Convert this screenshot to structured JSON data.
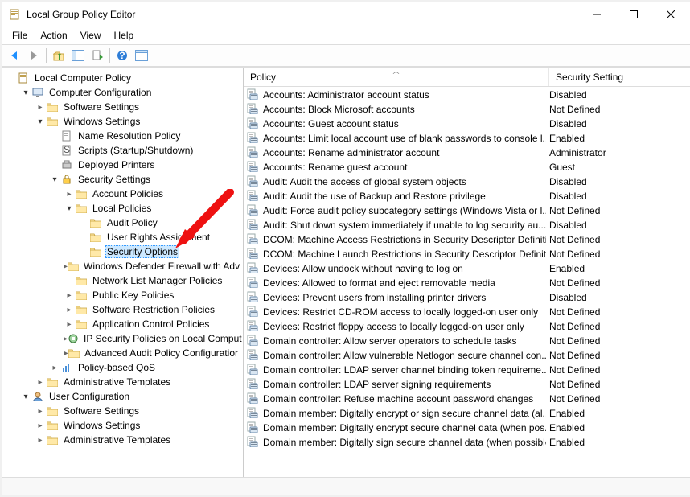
{
  "window": {
    "title": "Local Group Policy Editor"
  },
  "menu": {
    "file": "File",
    "action": "Action",
    "view": "View",
    "help": "Help"
  },
  "columns": {
    "policy": "Policy",
    "setting": "Security Setting"
  },
  "tree": [
    {
      "indent": 0,
      "chev": "none",
      "icon": "book",
      "label": "Local Computer Policy"
    },
    {
      "indent": 1,
      "chev": "open",
      "icon": "computer",
      "label": "Computer Configuration"
    },
    {
      "indent": 2,
      "chev": "closed",
      "icon": "folder",
      "label": "Software Settings"
    },
    {
      "indent": 2,
      "chev": "open",
      "icon": "folder",
      "label": "Windows Settings"
    },
    {
      "indent": 3,
      "chev": "none",
      "icon": "doc",
      "label": "Name Resolution Policy"
    },
    {
      "indent": 3,
      "chev": "none",
      "icon": "script",
      "label": "Scripts (Startup/Shutdown)"
    },
    {
      "indent": 3,
      "chev": "none",
      "icon": "printer",
      "label": "Deployed Printers"
    },
    {
      "indent": 3,
      "chev": "open",
      "icon": "security",
      "label": "Security Settings"
    },
    {
      "indent": 4,
      "chev": "closed",
      "icon": "folder",
      "label": "Account Policies"
    },
    {
      "indent": 4,
      "chev": "open",
      "icon": "folder",
      "label": "Local Policies"
    },
    {
      "indent": 5,
      "chev": "none",
      "icon": "folder",
      "label": "Audit Policy"
    },
    {
      "indent": 5,
      "chev": "none",
      "icon": "folder",
      "label": "User Rights Assignment"
    },
    {
      "indent": 5,
      "chev": "none",
      "icon": "folder",
      "label": "Security Options",
      "selected": true
    },
    {
      "indent": 4,
      "chev": "closed",
      "icon": "folder",
      "label": "Windows Defender Firewall with Adv"
    },
    {
      "indent": 4,
      "chev": "none",
      "icon": "folder",
      "label": "Network List Manager Policies"
    },
    {
      "indent": 4,
      "chev": "closed",
      "icon": "folder",
      "label": "Public Key Policies"
    },
    {
      "indent": 4,
      "chev": "closed",
      "icon": "folder",
      "label": "Software Restriction Policies"
    },
    {
      "indent": 4,
      "chev": "closed",
      "icon": "folder",
      "label": "Application Control Policies"
    },
    {
      "indent": 4,
      "chev": "closed",
      "icon": "ipsec",
      "label": "IP Security Policies on Local Comput"
    },
    {
      "indent": 4,
      "chev": "closed",
      "icon": "folder",
      "label": "Advanced Audit Policy Configuratior"
    },
    {
      "indent": 3,
      "chev": "closed",
      "icon": "qos",
      "label": "Policy-based QoS"
    },
    {
      "indent": 2,
      "chev": "closed",
      "icon": "folder",
      "label": "Administrative Templates"
    },
    {
      "indent": 1,
      "chev": "open",
      "icon": "user",
      "label": "User Configuration"
    },
    {
      "indent": 2,
      "chev": "closed",
      "icon": "folder",
      "label": "Software Settings"
    },
    {
      "indent": 2,
      "chev": "closed",
      "icon": "folder",
      "label": "Windows Settings"
    },
    {
      "indent": 2,
      "chev": "closed",
      "icon": "folder",
      "label": "Administrative Templates"
    }
  ],
  "policies": [
    {
      "name": "Accounts: Administrator account status",
      "setting": "Disabled"
    },
    {
      "name": "Accounts: Block Microsoft accounts",
      "setting": "Not Defined"
    },
    {
      "name": "Accounts: Guest account status",
      "setting": "Disabled"
    },
    {
      "name": "Accounts: Limit local account use of blank passwords to console l...",
      "setting": "Enabled"
    },
    {
      "name": "Accounts: Rename administrator account",
      "setting": "Administrator"
    },
    {
      "name": "Accounts: Rename guest account",
      "setting": "Guest"
    },
    {
      "name": "Audit: Audit the access of global system objects",
      "setting": "Disabled"
    },
    {
      "name": "Audit: Audit the use of Backup and Restore privilege",
      "setting": "Disabled"
    },
    {
      "name": "Audit: Force audit policy subcategory settings (Windows Vista or l...",
      "setting": "Not Defined"
    },
    {
      "name": "Audit: Shut down system immediately if unable to log security au...",
      "setting": "Disabled"
    },
    {
      "name": "DCOM: Machine Access Restrictions in Security Descriptor Definiti...",
      "setting": "Not Defined"
    },
    {
      "name": "DCOM: Machine Launch Restrictions in Security Descriptor Definit...",
      "setting": "Not Defined"
    },
    {
      "name": "Devices: Allow undock without having to log on",
      "setting": "Enabled"
    },
    {
      "name": "Devices: Allowed to format and eject removable media",
      "setting": "Not Defined"
    },
    {
      "name": "Devices: Prevent users from installing printer drivers",
      "setting": "Disabled"
    },
    {
      "name": "Devices: Restrict CD-ROM access to locally logged-on user only",
      "setting": "Not Defined"
    },
    {
      "name": "Devices: Restrict floppy access to locally logged-on user only",
      "setting": "Not Defined"
    },
    {
      "name": "Domain controller: Allow server operators to schedule tasks",
      "setting": "Not Defined"
    },
    {
      "name": "Domain controller: Allow vulnerable Netlogon secure channel con...",
      "setting": "Not Defined"
    },
    {
      "name": "Domain controller: LDAP server channel binding token requireme...",
      "setting": "Not Defined"
    },
    {
      "name": "Domain controller: LDAP server signing requirements",
      "setting": "Not Defined"
    },
    {
      "name": "Domain controller: Refuse machine account password changes",
      "setting": "Not Defined"
    },
    {
      "name": "Domain member: Digitally encrypt or sign secure channel data (al...",
      "setting": "Enabled"
    },
    {
      "name": "Domain member: Digitally encrypt secure channel data (when pos...",
      "setting": "Enabled"
    },
    {
      "name": "Domain member: Digitally sign secure channel data (when possible)",
      "setting": "Enabled"
    }
  ]
}
